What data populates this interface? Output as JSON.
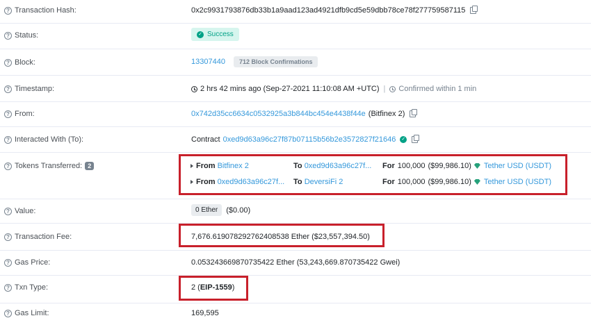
{
  "rows": {
    "tx_hash": {
      "label": "Transaction Hash:",
      "value": "0x2c9931793876db33b1a9aad123ad4921dfb9cd5e59dbb78ce78f277759587115"
    },
    "status": {
      "label": "Status:",
      "value": "Success"
    },
    "block": {
      "label": "Block:",
      "value": "13307440",
      "confirmations": "712 Block Confirmations"
    },
    "timestamp": {
      "label": "Timestamp:",
      "value": "2 hrs 42 mins ago (Sep-27-2021 11:10:08 AM +UTC)",
      "separator": "|",
      "confirmed": "Confirmed within 1 min"
    },
    "from": {
      "label": "From:",
      "address": "0x742d35cc6634c0532925a3b844bc454e4438f44e",
      "name": "(Bitfinex 2)"
    },
    "interacted": {
      "label": "Interacted With (To):",
      "prefix": "Contract",
      "address": "0xed9d63a96c27f87b07115b56b2e3572827f21646"
    },
    "tokens": {
      "label": "Tokens Transferred:",
      "count": "2",
      "transfers": [
        {
          "from_label": "From",
          "from": "Bitfinex 2",
          "to_label": "To",
          "to": "0xed9d63a96c27f...",
          "for_label": "For",
          "amount": "100,000",
          "usd": "($99,986.10)",
          "token": "Tether USD (USDT)"
        },
        {
          "from_label": "From",
          "from": "0xed9d63a96c27f...",
          "to_label": "To",
          "to": "DeversiFi 2",
          "for_label": "For",
          "amount": "100,000",
          "usd": "($99,986.10)",
          "token": "Tether USD (USDT)"
        }
      ]
    },
    "value": {
      "label": "Value:",
      "ether": "0 Ether",
      "usd": "($0.00)"
    },
    "fee": {
      "label": "Transaction Fee:",
      "value": "7,676.619078292762408538 Ether ($23,557,394.50)"
    },
    "gas_price": {
      "label": "Gas Price:",
      "value": "0.053243669870735422 Ether (53,243,669.870735422 Gwei)"
    },
    "txn_type": {
      "label": "Txn Type:",
      "prefix": "2 (",
      "type": "EIP-1559",
      "suffix": ")"
    },
    "gas_limit": {
      "label": "Gas Limit:",
      "value": "169,595"
    }
  },
  "icons": {
    "question": "?",
    "check": "✓"
  },
  "colors": {
    "link": "#3498db",
    "success": "#00a186",
    "highlight_box": "#c8202b"
  }
}
